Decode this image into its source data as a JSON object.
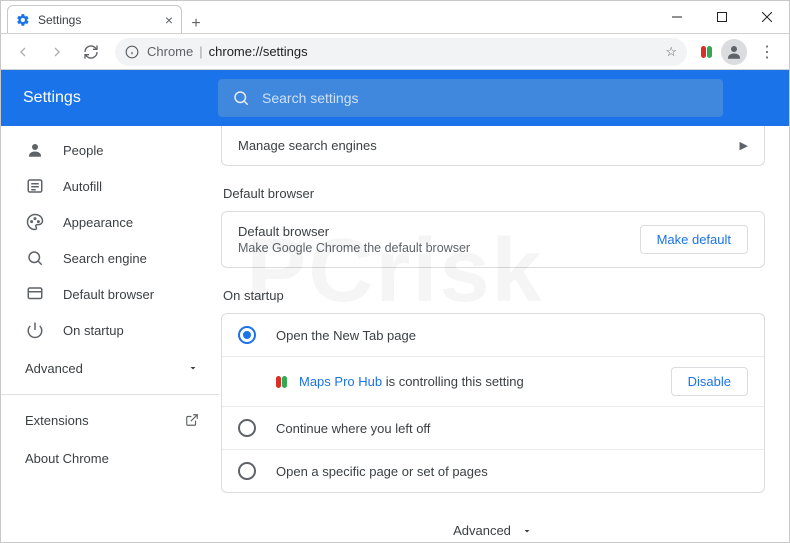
{
  "window": {
    "tab_title": "Settings"
  },
  "toolbar": {
    "url_origin": "Chrome",
    "url_path": "chrome://settings"
  },
  "header": {
    "title": "Settings",
    "search_placeholder": "Search settings"
  },
  "sidebar": {
    "items": [
      {
        "label": "People",
        "icon": "person-icon"
      },
      {
        "label": "Autofill",
        "icon": "autofill-icon"
      },
      {
        "label": "Appearance",
        "icon": "palette-icon"
      },
      {
        "label": "Search engine",
        "icon": "search-icon"
      },
      {
        "label": "Default browser",
        "icon": "browser-icon"
      },
      {
        "label": "On startup",
        "icon": "power-icon"
      }
    ],
    "advanced": "Advanced",
    "extensions": "Extensions",
    "about": "About Chrome"
  },
  "main": {
    "manage_search": "Manage search engines",
    "default_browser_section": "Default browser",
    "default_browser_title": "Default browser",
    "default_browser_sub": "Make Google Chrome the default browser",
    "make_default": "Make default",
    "startup_section": "On startup",
    "radio_newtab": "Open the New Tab page",
    "radio_continue": "Continue where you left off",
    "radio_specific": "Open a specific page or set of pages",
    "controlling_ext": "Maps Pro Hub",
    "controlling_rest": " is controlling this setting",
    "disable": "Disable",
    "advanced_footer": "Advanced"
  },
  "watermark": "PCrisk"
}
